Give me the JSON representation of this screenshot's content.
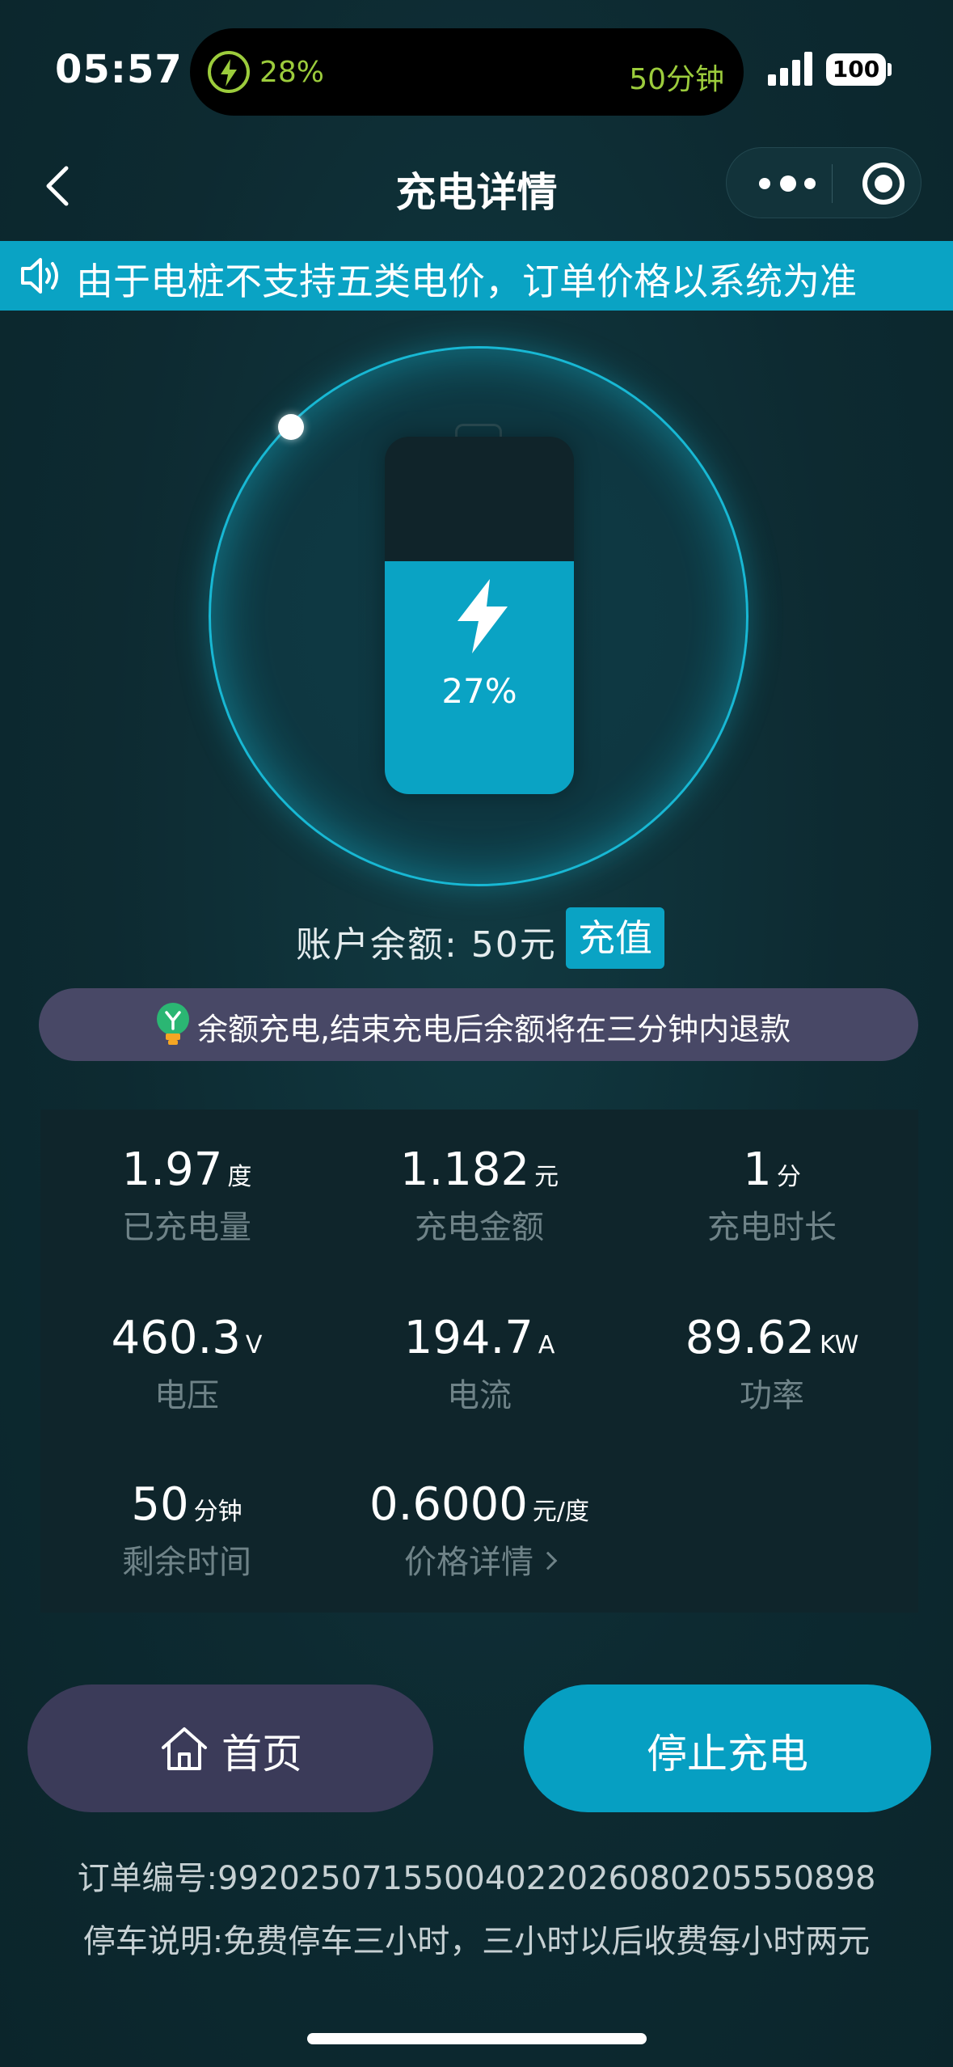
{
  "status_bar": {
    "time": "05:57",
    "island_battery": "28%",
    "island_time": "50分钟",
    "battery_level": "100"
  },
  "nav": {
    "title": "充电详情"
  },
  "notice": {
    "text": "由于电桩不支持五类电价，订单价格以系统为准"
  },
  "battery": {
    "percent_text": "27%",
    "level": 0.27
  },
  "account": {
    "balance_label": "账户余额: 50元",
    "recharge_label": "充值"
  },
  "tip": {
    "text": "余额充电,结束充电后余额将在三分钟内退款"
  },
  "stats": {
    "energy": {
      "value": "1.97",
      "unit": "度",
      "label": "已充电量"
    },
    "amount": {
      "value": "1.182",
      "unit": "元",
      "label": "充电金额"
    },
    "duration": {
      "value": "1",
      "unit": "分",
      "label": "充电时长"
    },
    "voltage": {
      "value": "460.3",
      "unit": "V",
      "label": "电压"
    },
    "current": {
      "value": "194.7",
      "unit": "A",
      "label": "电流"
    },
    "power": {
      "value": "89.62",
      "unit": "KW",
      "label": "功率"
    },
    "remaining": {
      "value": "50",
      "unit": "分钟",
      "label": "剩余时间"
    },
    "price": {
      "value": "0.6000",
      "unit": "元/度",
      "label": "价格详情"
    }
  },
  "actions": {
    "home_label": "首页",
    "stop_label": "停止充电"
  },
  "footer": {
    "order_no": "订单编号:99202507155004022026080205550898",
    "parking": "停车说明:免费停车三小时，三小时以后收费每小时两元"
  },
  "colors": {
    "accent": "#0aa3c4",
    "background": "#0e2a30",
    "island_green": "#9ccc3c"
  }
}
